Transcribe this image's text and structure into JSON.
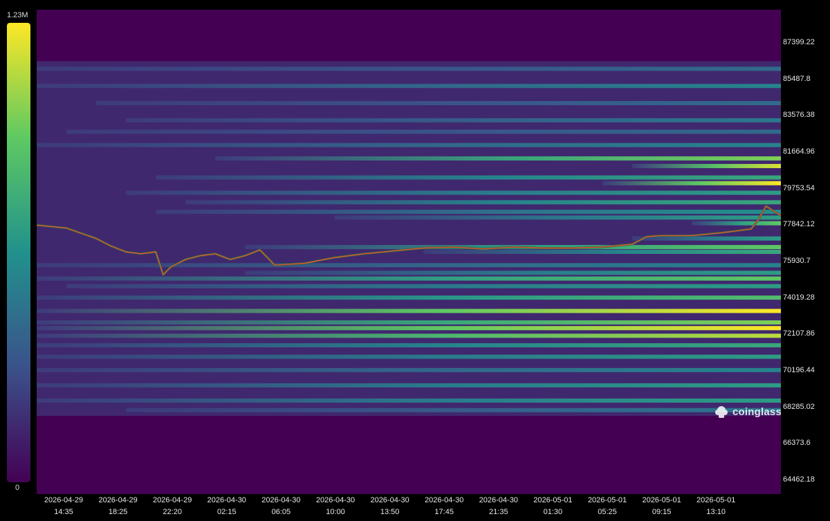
{
  "watermark": "coinglass",
  "colorbar": {
    "max_label": "1.23M",
    "min_label": "0"
  },
  "chart_data": {
    "type": "heatmap",
    "title": "",
    "xlabel": "",
    "ylabel": "",
    "ylim": [
      63700,
      89100
    ],
    "colorscale": [
      "#440154",
      "#3b528b",
      "#21918c",
      "#5ec962",
      "#fde725"
    ],
    "y_ticks": [
      "87399.22",
      "85487.8",
      "83576.38",
      "81664.96",
      "79753.54",
      "77842.12",
      "75930.7",
      "74019.28",
      "72107.86",
      "70196.44",
      "68285.02",
      "66373.6",
      "64462.18"
    ],
    "x_ticks": [
      {
        "date": "2026-04-29",
        "time": "14:35"
      },
      {
        "date": "2026-04-29",
        "time": "18:25"
      },
      {
        "date": "2026-04-29",
        "time": "22:20"
      },
      {
        "date": "2026-04-30",
        "time": "02:15"
      },
      {
        "date": "2026-04-30",
        "time": "06:05"
      },
      {
        "date": "2026-04-30",
        "time": "10:00"
      },
      {
        "date": "2026-04-30",
        "time": "13:50"
      },
      {
        "date": "2026-04-30",
        "time": "17:45"
      },
      {
        "date": "2026-04-30",
        "time": "21:35"
      },
      {
        "date": "2026-05-01",
        "time": "01:30"
      },
      {
        "date": "2026-05-01",
        "time": "05:25"
      },
      {
        "date": "2026-05-01",
        "time": "09:15"
      },
      {
        "date": "2026-05-01",
        "time": "13:10"
      }
    ],
    "price_series": {
      "name": "",
      "hours_from_start": [
        0,
        2,
        4,
        5,
        6,
        7,
        8,
        8.5,
        9,
        10,
        11,
        12,
        13,
        14,
        15,
        16,
        18,
        20,
        22,
        24,
        26,
        28,
        30,
        32,
        34,
        36,
        38,
        40,
        41,
        42,
        44,
        46,
        47,
        48,
        48.5,
        49,
        50
      ],
      "price": [
        77800,
        77650,
        77100,
        76700,
        76400,
        76300,
        76400,
        75200,
        75600,
        76000,
        76200,
        76300,
        76000,
        76200,
        76500,
        75700,
        75800,
        76100,
        76300,
        76450,
        76600,
        76650,
        76550,
        76650,
        76600,
        76600,
        76650,
        76800,
        77200,
        77250,
        77250,
        77400,
        77500,
        77600,
        78100,
        78800,
        78300
      ]
    },
    "liquidity_bands": [
      {
        "price": 86000,
        "intensity": 0.35,
        "start_hour": 0
      },
      {
        "price": 85100,
        "intensity": 0.45,
        "start_hour": 0
      },
      {
        "price": 84200,
        "intensity": 0.35,
        "start_hour": 4
      },
      {
        "price": 83300,
        "intensity": 0.4,
        "start_hour": 6
      },
      {
        "price": 82700,
        "intensity": 0.35,
        "start_hour": 2
      },
      {
        "price": 82000,
        "intensity": 0.45,
        "start_hour": 0
      },
      {
        "price": 81300,
        "intensity": 0.8,
        "start_hour": 12
      },
      {
        "price": 80900,
        "intensity": 0.95,
        "start_hour": 40
      },
      {
        "price": 80300,
        "intensity": 0.6,
        "start_hour": 8
      },
      {
        "price": 80000,
        "intensity": 1.0,
        "start_hour": 38
      },
      {
        "price": 79500,
        "intensity": 0.55,
        "start_hour": 6
      },
      {
        "price": 79000,
        "intensity": 0.6,
        "start_hour": 10
      },
      {
        "price": 78500,
        "intensity": 0.5,
        "start_hour": 8
      },
      {
        "price": 78200,
        "intensity": 0.55,
        "start_hour": 20
      },
      {
        "price": 77900,
        "intensity": 0.75,
        "start_hour": 44
      },
      {
        "price": 77100,
        "intensity": 0.55,
        "start_hour": 40
      },
      {
        "price": 76650,
        "intensity": 0.75,
        "start_hour": 14
      },
      {
        "price": 76400,
        "intensity": 0.6,
        "start_hour": 26
      },
      {
        "price": 75700,
        "intensity": 0.45,
        "start_hour": 0
      },
      {
        "price": 75300,
        "intensity": 0.55,
        "start_hour": 14
      },
      {
        "price": 75000,
        "intensity": 0.75,
        "start_hour": 0
      },
      {
        "price": 74600,
        "intensity": 0.55,
        "start_hour": 2
      },
      {
        "price": 74000,
        "intensity": 0.7,
        "start_hour": 0
      },
      {
        "price": 73300,
        "intensity": 1.0,
        "start_hour": 0
      },
      {
        "price": 72700,
        "intensity": 0.8,
        "start_hour": 0
      },
      {
        "price": 72400,
        "intensity": 1.0,
        "start_hour": 0
      },
      {
        "price": 72000,
        "intensity": 0.9,
        "start_hour": 0
      },
      {
        "price": 71500,
        "intensity": 0.6,
        "start_hour": 0
      },
      {
        "price": 70900,
        "intensity": 0.55,
        "start_hour": 0
      },
      {
        "price": 70200,
        "intensity": 0.45,
        "start_hour": 0
      },
      {
        "price": 69400,
        "intensity": 0.55,
        "start_hour": 0
      },
      {
        "price": 68600,
        "intensity": 0.55,
        "start_hour": 0
      },
      {
        "price": 68100,
        "intensity": 0.4,
        "start_hour": 6
      }
    ],
    "data_span": {
      "price_top": 86400,
      "price_bottom": 67800,
      "hours": 50
    }
  }
}
